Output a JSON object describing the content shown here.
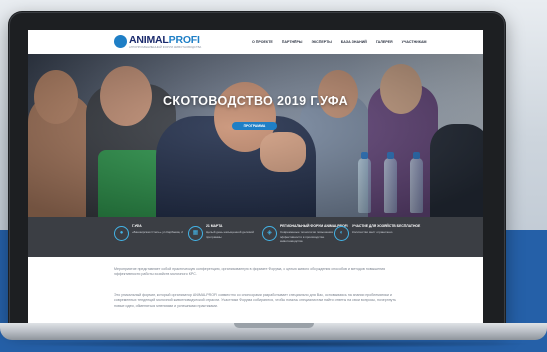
{
  "header": {
    "logo_text_a": "ANIMAL",
    "logo_text_b": "PROFI",
    "logo_subtitle": "АГРОПРОМЫШЛЕННЫЙ ФОРУМ ЖИВОТНОВОДСТВА",
    "nav": [
      "О ПРОЕКТЕ",
      "ПАРТНЁРЫ",
      "ЭКСПЕРТЫ",
      "БАЗА ЗНАНИЙ",
      "ГАЛЕРЕЯ",
      "УЧАСТНИКАМ"
    ]
  },
  "hero": {
    "title": "СКОТОВОДСТВО 2019 Г.УФА",
    "button_label": "ПРОГРАММА"
  },
  "features": [
    {
      "icon": "location-icon",
      "title": "Г.УФА",
      "desc": "«Башкирская Степь» ул.Карбаева, 2"
    },
    {
      "icon": "calendar-icon",
      "title": "21 МАРТА",
      "desc": "Целый день насыщенной деловой программы"
    },
    {
      "icon": "forum-icon",
      "title": "РЕГИОНАЛЬНЫЙ ФОРУМ ANIMALPROFI",
      "desc": "Современные технологии повышения эффективности в производстве животноводства"
    },
    {
      "icon": "users-icon",
      "title": "УЧАСТИЕ ДЛЯ ХОЗЯЙСТВ БЕСПЛАТНОЕ",
      "desc": "Количество мест ограничено"
    }
  ],
  "content": {
    "para1": "Мероприятие представляет собой практическую конференцию, организованную в формате Форума, с целью живого обсуждения способов и методов повышения эффективности работы хозяйств молочного КРС.",
    "para2": "Это уникальный формат, который организатор ANIMALPROFI совместно со спонсорами разработывает специально для Вас, основываясь на знании проблематики и современных тенденций молочной животноводческой отрасли. Участники Форума собираются, чтобы помочь специалистам найти ответы на свои вопросы, почерпнуть новые идеи, обменяться мнениями и успешными практиками."
  },
  "colors": {
    "accent": "#1f7fc6",
    "band": "#2560a8",
    "features_bg": "#3b3e44"
  }
}
